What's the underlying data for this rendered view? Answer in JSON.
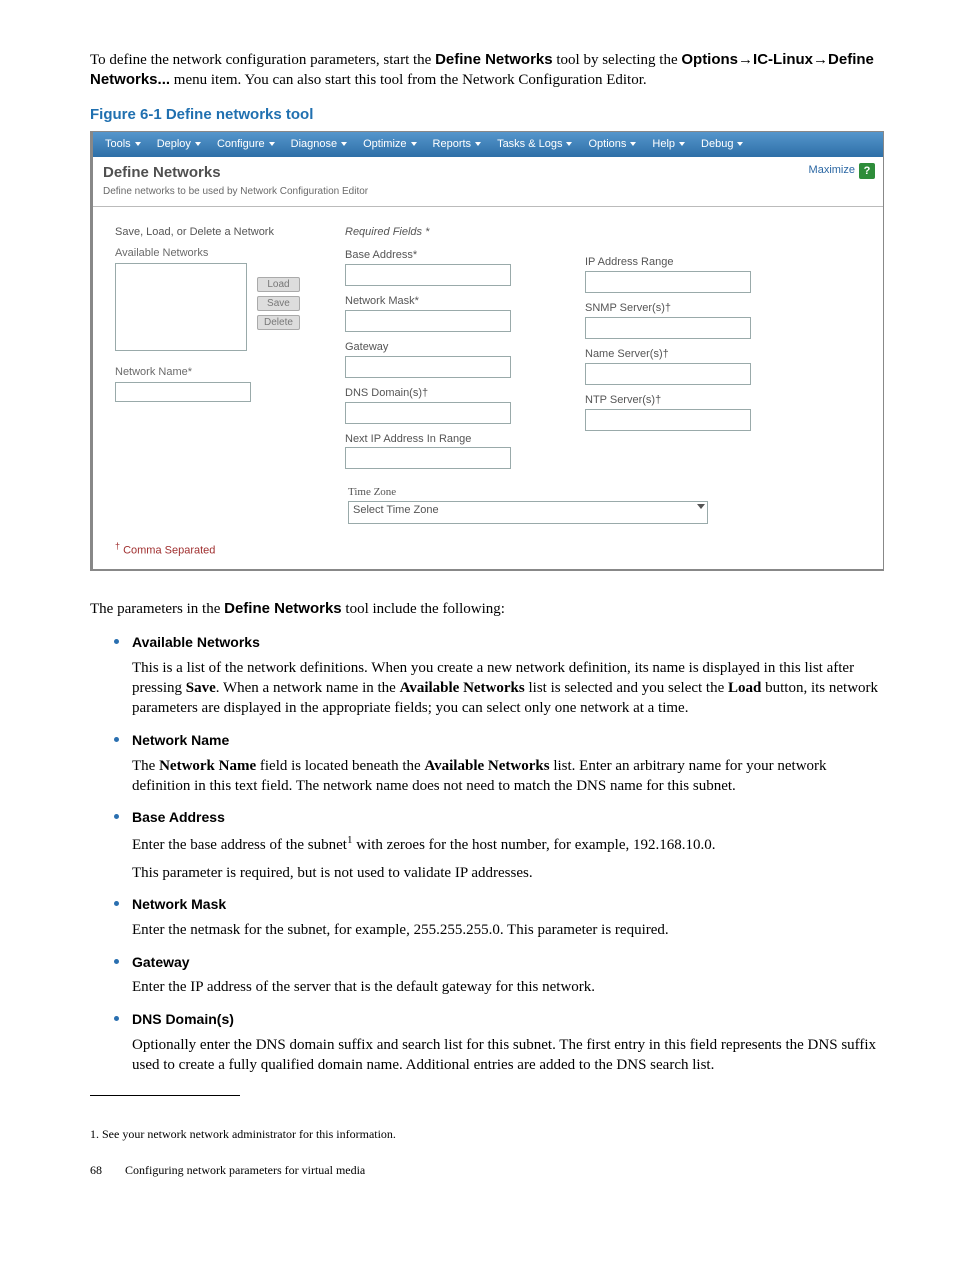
{
  "intro": {
    "pre": "To define the network configuration parameters, start the ",
    "bold1": "Define Networks",
    "mid1": " tool by selecting the ",
    "bold2": "Options",
    "arrow": "→",
    "bold3": "IC-Linux",
    "bold4": "Define Networks...",
    "post": " menu item. You can also start this tool from the Network Configuration Editor."
  },
  "figure_caption": "Figure 6-1 Define networks tool",
  "tool": {
    "menu": [
      "Tools",
      "Deploy",
      "Configure",
      "Diagnose",
      "Optimize",
      "Reports",
      "Tasks & Logs",
      "Options",
      "Help",
      "Debug"
    ],
    "title": "Define Networks",
    "subtitle": "Define networks to be used by Network Configuration Editor",
    "maximize": "Maximize",
    "help_q": "?",
    "left_heading": "Save, Load, or Delete a Network",
    "avail_label": "Available Networks",
    "btn_load": "Load",
    "btn_save": "Save",
    "btn_delete": "Delete",
    "net_name_label": "Network Name*",
    "req_hdr": "Required Fields *",
    "labels": {
      "base_addr": "Base Address*",
      "netmask": "Network Mask*",
      "gateway": "Gateway",
      "dns": "DNS Domain(s)†",
      "nextip": "Next IP Address In Range",
      "iprange": "IP Address Range",
      "snmp": "SNMP Server(s)†",
      "nameserv": "Name Server(s)†",
      "ntp": "NTP Server(s)†"
    },
    "tz_label": "Time Zone",
    "tz_value": "Select Time Zone",
    "footnote": "† Comma Separated"
  },
  "params_intro_pre": "The parameters in the ",
  "params_intro_bold": "Define Networks",
  "params_intro_post": " tool include the following:",
  "items": [
    {
      "label": "Available Networks",
      "body": [
        "This is a list of the network definitions. When you create a new network definition, its name is displayed in this list after pressing <b>Save</b>. When a network name in the <b>Available Networks</b> list is selected and you select the <b>Load</b> button, its network parameters are displayed in the appropriate fields; you can select only one network at a time."
      ]
    },
    {
      "label": "Network Name",
      "body": [
        "The <b>Network Name</b> field is located beneath the <b>Available Networks</b> list. Enter an arbitrary name for your network definition in this text field. The network name does not need to match the DNS name for this subnet."
      ]
    },
    {
      "label": "Base Address",
      "body": [
        "Enter the base address of the subnet<span class='super1'>1</span> with zeroes for the host number, for example, 192.168.10.0.",
        "This parameter is required, but is not used to validate IP addresses."
      ]
    },
    {
      "label": "Network Mask",
      "body": [
        "Enter the netmask for the subnet, for example, 255.255.255.0. This parameter is required."
      ]
    },
    {
      "label": "Gateway",
      "body": [
        "Enter the IP address of the server that is the default gateway for this network."
      ]
    },
    {
      "label": "DNS Domain(s)",
      "body": [
        "Optionally enter the DNS domain suffix and search list for this subnet. The first entry in this field represents the DNS suffix used to create a fully qualified domain name. Additional entries are added to the DNS search list."
      ]
    }
  ],
  "footnote1": "1.   See your network network administrator for this information.",
  "pagefoot_num": "68",
  "pagefoot_text": "Configuring network parameters for virtual media"
}
